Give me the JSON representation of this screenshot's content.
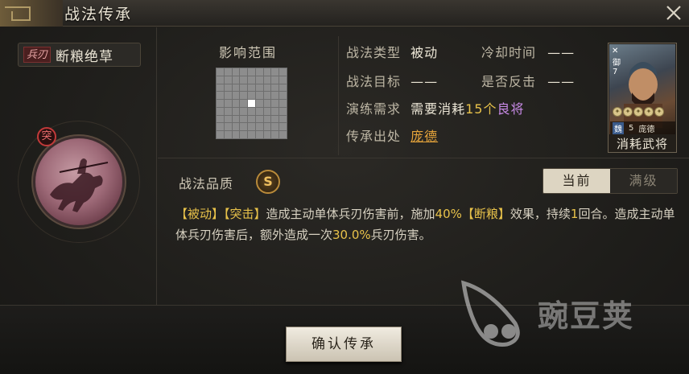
{
  "window": {
    "title": "战法传承"
  },
  "skill": {
    "type_badge": "兵刃",
    "name": "断粮绝草",
    "assault_badge": "突"
  },
  "range": {
    "title": "影响范围",
    "grid_size": 9,
    "selected_cell": "center"
  },
  "info": {
    "type_label": "战法类型",
    "type_value": "被动",
    "cooldown_label": "冷却时间",
    "cooldown_value": "——",
    "target_label": "战法目标",
    "target_value": "——",
    "counter_label": "是否反击",
    "counter_value": "——",
    "requirement_label": "演练需求",
    "requirement_prefix": "需要消耗",
    "requirement_count": "15个",
    "requirement_item": "良将",
    "source_label": "传承出处",
    "source_value": "庞德"
  },
  "general_card": {
    "side_text": "御7",
    "stars": 5,
    "faction": "魏",
    "cost": "5",
    "name": "庞德",
    "caption": "消耗武将"
  },
  "quality": {
    "label": "战法品质",
    "grade": "S"
  },
  "level_toggle": {
    "current": "当前",
    "max": "满级"
  },
  "description": {
    "tag1": "【被动】",
    "tag2": "【突击】",
    "part1": "造成主动单体兵刃伤害前，施加",
    "pct1": "40%",
    "tag3": "【断粮】",
    "part2": "效果，持续",
    "num1": "1",
    "part3": "回合。造成主动单体兵刃伤害后，额外造成一次",
    "pct2": "30.0%",
    "part4": "兵刃伤害。"
  },
  "footer": {
    "confirm_label": "确认传承"
  },
  "watermark": {
    "text": "豌豆荚"
  },
  "colors": {
    "accent_yellow": "#e8c24a",
    "accent_purple": "#c88ae6",
    "accent_orange": "#e7a53b",
    "badge_red": "#c23a3a"
  }
}
